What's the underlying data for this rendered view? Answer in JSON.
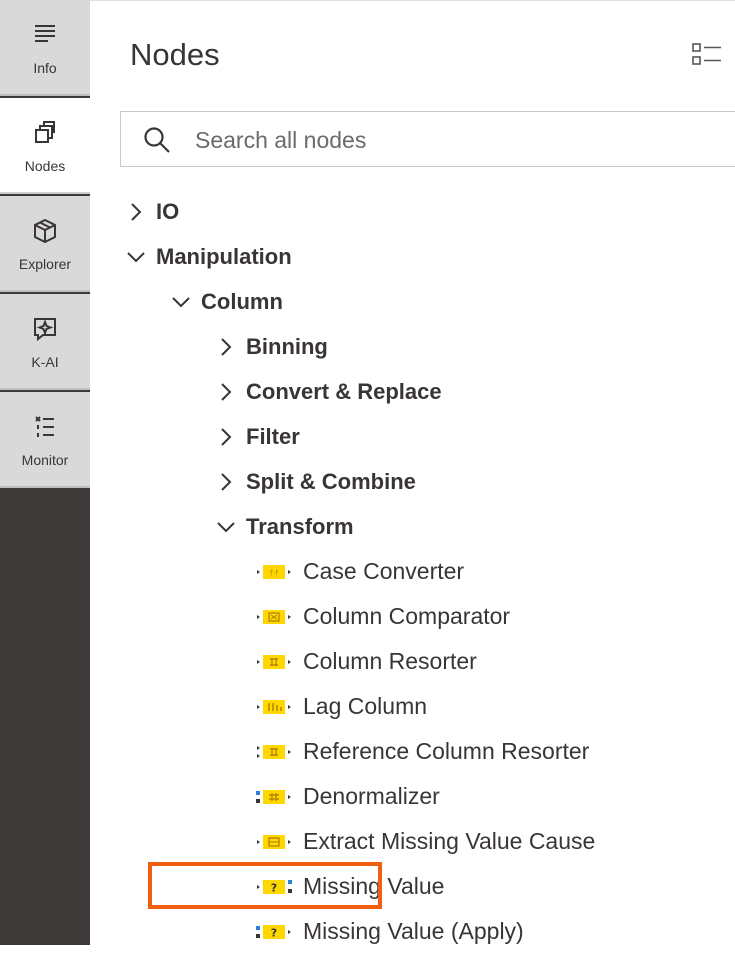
{
  "sidebar": {
    "items": [
      {
        "label": "Info",
        "icon": "list-lines-icon"
      },
      {
        "label": "Nodes",
        "icon": "nodes-stack-icon"
      },
      {
        "label": "Explorer",
        "icon": "cube-icon"
      },
      {
        "label": "K-AI",
        "icon": "sparkle-chat-icon"
      },
      {
        "label": "Monitor",
        "icon": "monitor-list-icon"
      }
    ],
    "active": "Nodes"
  },
  "panel": {
    "title": "Nodes",
    "view_toggle_icon": "list-view-icon"
  },
  "search": {
    "placeholder": "Search all nodes",
    "value": ""
  },
  "tree": {
    "categories": [
      {
        "label": "IO",
        "expanded": false
      },
      {
        "label": "Manipulation",
        "expanded": true
      },
      {
        "label": "Column",
        "expanded": true
      },
      {
        "label": "Binning",
        "expanded": false
      },
      {
        "label": "Convert & Replace",
        "expanded": false
      },
      {
        "label": "Filter",
        "expanded": false
      },
      {
        "label": "Split & Combine",
        "expanded": false
      },
      {
        "label": "Transform",
        "expanded": true
      }
    ],
    "nodes": [
      {
        "label": "Case Converter",
        "icon": "case-converter-node-icon"
      },
      {
        "label": "Column Comparator",
        "icon": "column-comparator-node-icon"
      },
      {
        "label": "Column Resorter",
        "icon": "column-resorter-node-icon"
      },
      {
        "label": "Lag Column",
        "icon": "lag-column-node-icon"
      },
      {
        "label": "Reference Column Resorter",
        "icon": "reference-column-resorter-node-icon"
      },
      {
        "label": "Denormalizer",
        "icon": "denormalizer-node-icon"
      },
      {
        "label": "Extract Missing Value Cause",
        "icon": "extract-missing-value-cause-node-icon"
      },
      {
        "label": "Missing Value",
        "icon": "missing-value-node-icon"
      },
      {
        "label": "Missing Value (Apply)",
        "icon": "missing-value-apply-node-icon"
      }
    ],
    "highlighted_node": "Missing Value"
  },
  "colors": {
    "sidebar_bg": "#3e3a39",
    "tab_bg": "#d9d9d9",
    "node_icon_yellow": "#ffd800",
    "highlight_orange": "#f0600f"
  }
}
